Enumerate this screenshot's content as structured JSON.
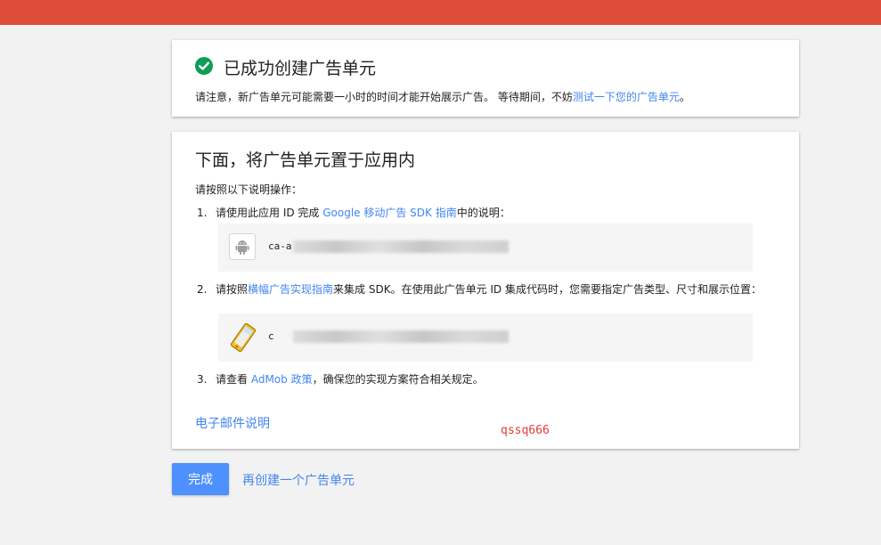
{
  "colors": {
    "topbar": "#dd4b39",
    "success": "#0f9d58",
    "link": "#4285f4",
    "primary_button": "#4d90fe",
    "watermark": "#e53935"
  },
  "success_card": {
    "icon": "check-circle-icon",
    "title": "已成功创建广告单元",
    "notice_prefix": "请注意，新广告单元可能需要一小时的时间才能开始展示广告。 等待期间，不妨",
    "notice_link": "测试一下您的广告单元",
    "notice_suffix": "。"
  },
  "instructions_card": {
    "title": "下面，将广告单元置于应用内",
    "intro": "请按照以下说明操作：",
    "steps": [
      {
        "number": "1.",
        "prefix": "请使用此应用 ID 完成 ",
        "link": "Google 移动广告 SDK 指南",
        "suffix": "中的说明：",
        "id_icon": "android-icon",
        "id_value": "ca-a"
      },
      {
        "number": "2.",
        "prefix": "请按照",
        "link": "横幅广告实现指南",
        "suffix": "来集成 SDK。在使用此广告单元 ID 集成代码时，您需要指定广告类型、尺寸和展示位置：",
        "id_icon": "mobile-device-icon",
        "id_value": "c"
      },
      {
        "number": "3.",
        "prefix": "请查看 ",
        "link": "AdMob 政策",
        "suffix": "，确保您的实现方案符合相关规定。"
      }
    ],
    "email_link": "电子邮件说明",
    "watermark": "qssq666"
  },
  "actions": {
    "done_label": "完成",
    "create_another_label": "再创建一个广告单元"
  }
}
